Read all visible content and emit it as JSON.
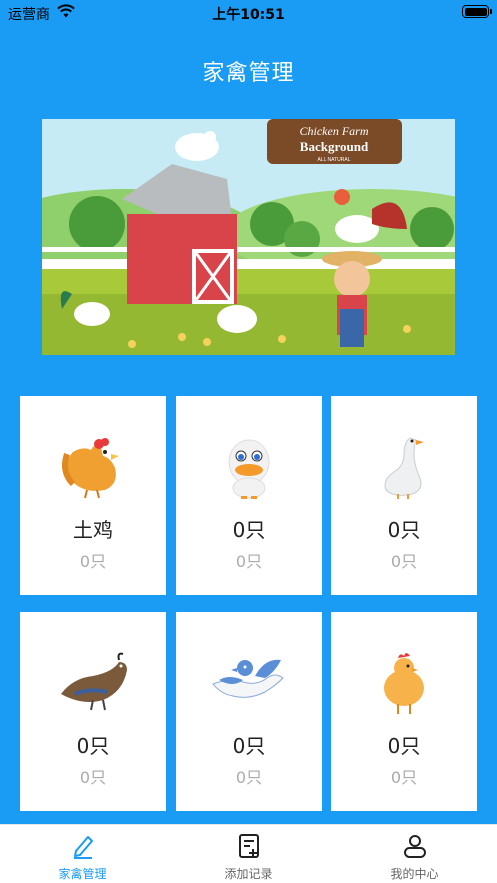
{
  "status_bar": {
    "carrier": "运营商",
    "time": "上午10:51"
  },
  "header": {
    "title": "家禽管理"
  },
  "banner": {
    "sign_line1": "Chicken Farm",
    "sign_line2": "Background",
    "sign_line3": "ALL NATURAL"
  },
  "cards": [
    {
      "title": "土鸡",
      "count": "0只",
      "icon": "hen-icon"
    },
    {
      "title": "0只",
      "count": "0只",
      "icon": "duck-icon"
    },
    {
      "title": "0只",
      "count": "0只",
      "icon": "goose-icon"
    },
    {
      "title": "0只",
      "count": "0只",
      "icon": "quail-icon"
    },
    {
      "title": "0只",
      "count": "0只",
      "icon": "pigeon-icon"
    },
    {
      "title": "0只",
      "count": "0只",
      "icon": "chicken-icon"
    }
  ],
  "tabbar": {
    "tabs": [
      {
        "label": "家禽管理",
        "icon": "pencil-icon",
        "active": true
      },
      {
        "label": "添加记录",
        "icon": "add-record-icon",
        "active": false
      },
      {
        "label": "我的中心",
        "icon": "user-icon",
        "active": false
      }
    ]
  },
  "colors": {
    "primary": "#1a9cf5",
    "card": "#ffffff",
    "muted": "#aaaaaa"
  }
}
